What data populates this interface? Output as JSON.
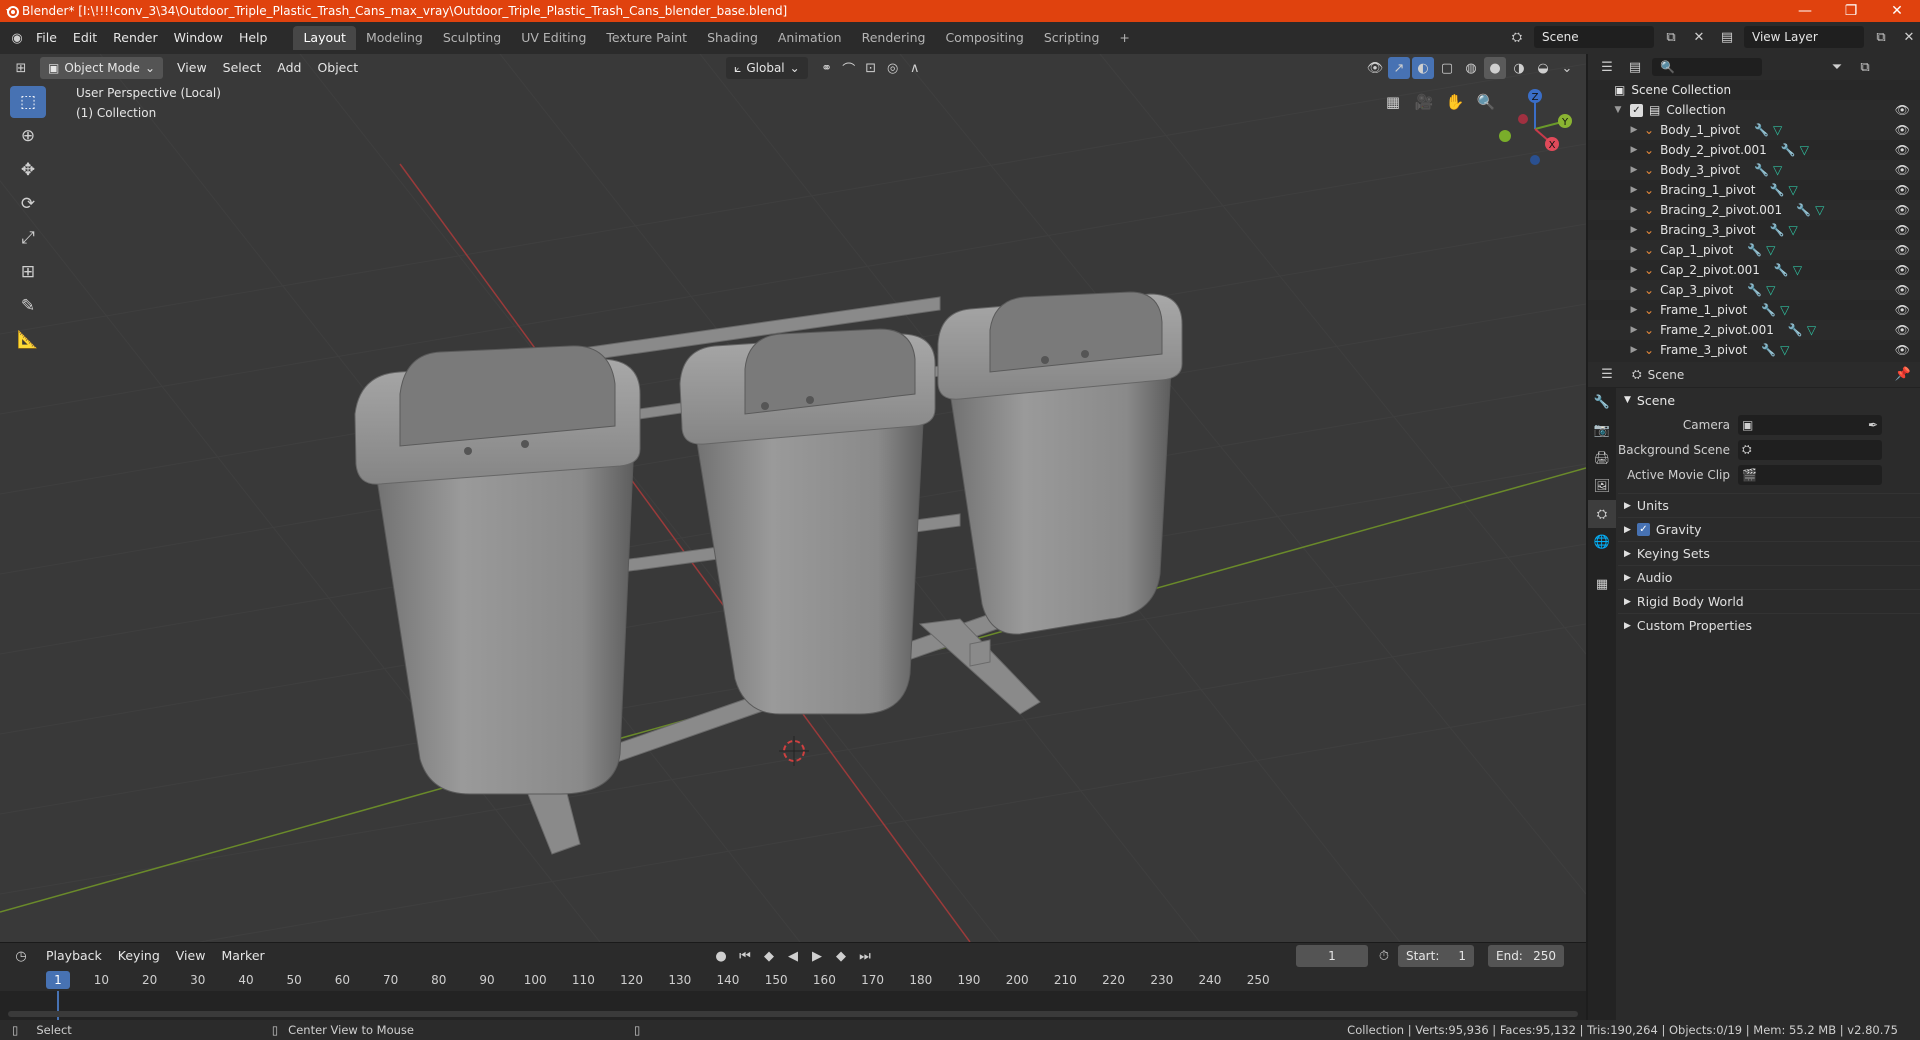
{
  "titlebar": {
    "title": "Blender* [I:\\!!!!conv_3\\34\\Outdoor_Triple_Plastic_Trash_Cans_max_vray\\Outdoor_Triple_Plastic_Trash_Cans_blender_base.blend]",
    "minimize": "—",
    "restore": "❐",
    "close": "✕"
  },
  "menu": [
    "File",
    "Edit",
    "Render",
    "Window",
    "Help"
  ],
  "workspaces": [
    "Layout",
    "Modeling",
    "Sculpting",
    "UV Editing",
    "Texture Paint",
    "Shading",
    "Animation",
    "Rendering",
    "Compositing",
    "Scripting"
  ],
  "workspace_add": "+",
  "scene_field": "Scene",
  "view_layer_field": "View Layer",
  "viewport": {
    "mode": "Object Mode",
    "menus": [
      "View",
      "Select",
      "Add",
      "Object"
    ],
    "orientation": "Global",
    "info_line1": "User Perspective (Local)",
    "info_line2": "(1) Collection",
    "gizmo": {
      "x": "X",
      "y": "Y",
      "z": "Z"
    }
  },
  "timeline": {
    "menus": [
      "Playback",
      "Keying",
      "View",
      "Marker"
    ],
    "current_frame": "1",
    "start_label": "Start:",
    "start": "1",
    "end_label": "End:",
    "end": "250",
    "ruler_current": "1",
    "ticks": [
      "10",
      "20",
      "30",
      "40",
      "50",
      "60",
      "70",
      "80",
      "90",
      "100",
      "110",
      "120",
      "130",
      "140",
      "150",
      "160",
      "170",
      "180",
      "190",
      "200",
      "210",
      "220",
      "230",
      "240",
      "250"
    ]
  },
  "statusbar": {
    "left1": "Select",
    "left2": "Center View to Mouse",
    "right": "Collection | Verts:95,936 | Faces:95,132 | Tris:190,264 | Objects:0/19 | Mem: 55.2 MB | v2.80.75"
  },
  "outliner": {
    "root": "Scene Collection",
    "collection": "Collection",
    "items": [
      "Body_1_pivot",
      "Body_2_pivot.001",
      "Body_3_pivot",
      "Bracing_1_pivot",
      "Bracing_2_pivot.001",
      "Bracing_3_pivot",
      "Cap_1_pivot",
      "Cap_2_pivot.001",
      "Cap_3_pivot",
      "Frame_1_pivot",
      "Frame_2_pivot.001",
      "Frame_3_pivot"
    ]
  },
  "properties": {
    "context": "Scene",
    "panel": "Scene",
    "camera_label": "Camera",
    "background_label": "Background Scene",
    "movieclip_label": "Active Movie Clip",
    "sections": [
      "Units",
      "Gravity",
      "Keying Sets",
      "Audio",
      "Rigid Body World",
      "Custom Properties"
    ]
  }
}
